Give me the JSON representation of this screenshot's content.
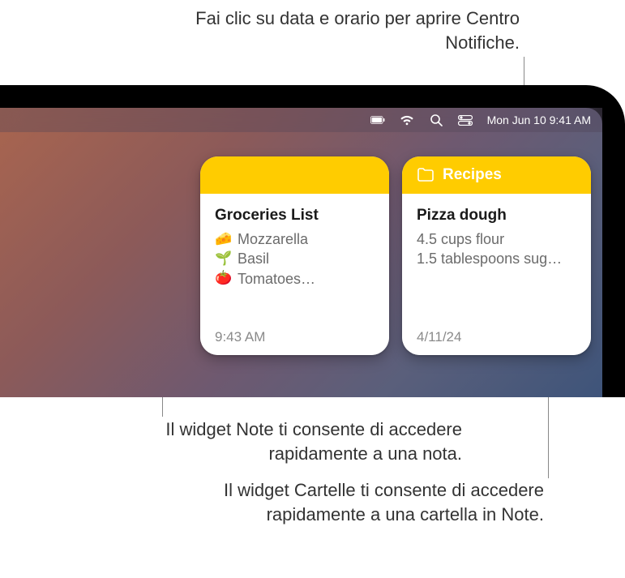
{
  "callouts": {
    "top": "Fai clic su data e orario per aprire Centro Notifiche.",
    "mid": "Il widget Note ti consente di accedere rapidamente a una nota.",
    "bottom": "Il widget Cartelle ti consente di accedere rapidamente a una cartella in Note."
  },
  "menubar": {
    "datetime": "Mon Jun 10  9:41 AM"
  },
  "widgets": [
    {
      "header": "",
      "title": "Groceries List",
      "lines": [
        {
          "emoji": "🧀",
          "text": "Mozzarella"
        },
        {
          "emoji": "🌱",
          "text": "Basil"
        },
        {
          "emoji": "🍅",
          "text": "Tomatoes…"
        }
      ],
      "footer": "9:43 AM"
    },
    {
      "header": "Recipes",
      "title": "Pizza dough",
      "lines": [
        {
          "emoji": "",
          "text": "4.5 cups flour"
        },
        {
          "emoji": "",
          "text": "1.5 tablespoons sug…"
        }
      ],
      "footer": "4/11/24"
    }
  ]
}
